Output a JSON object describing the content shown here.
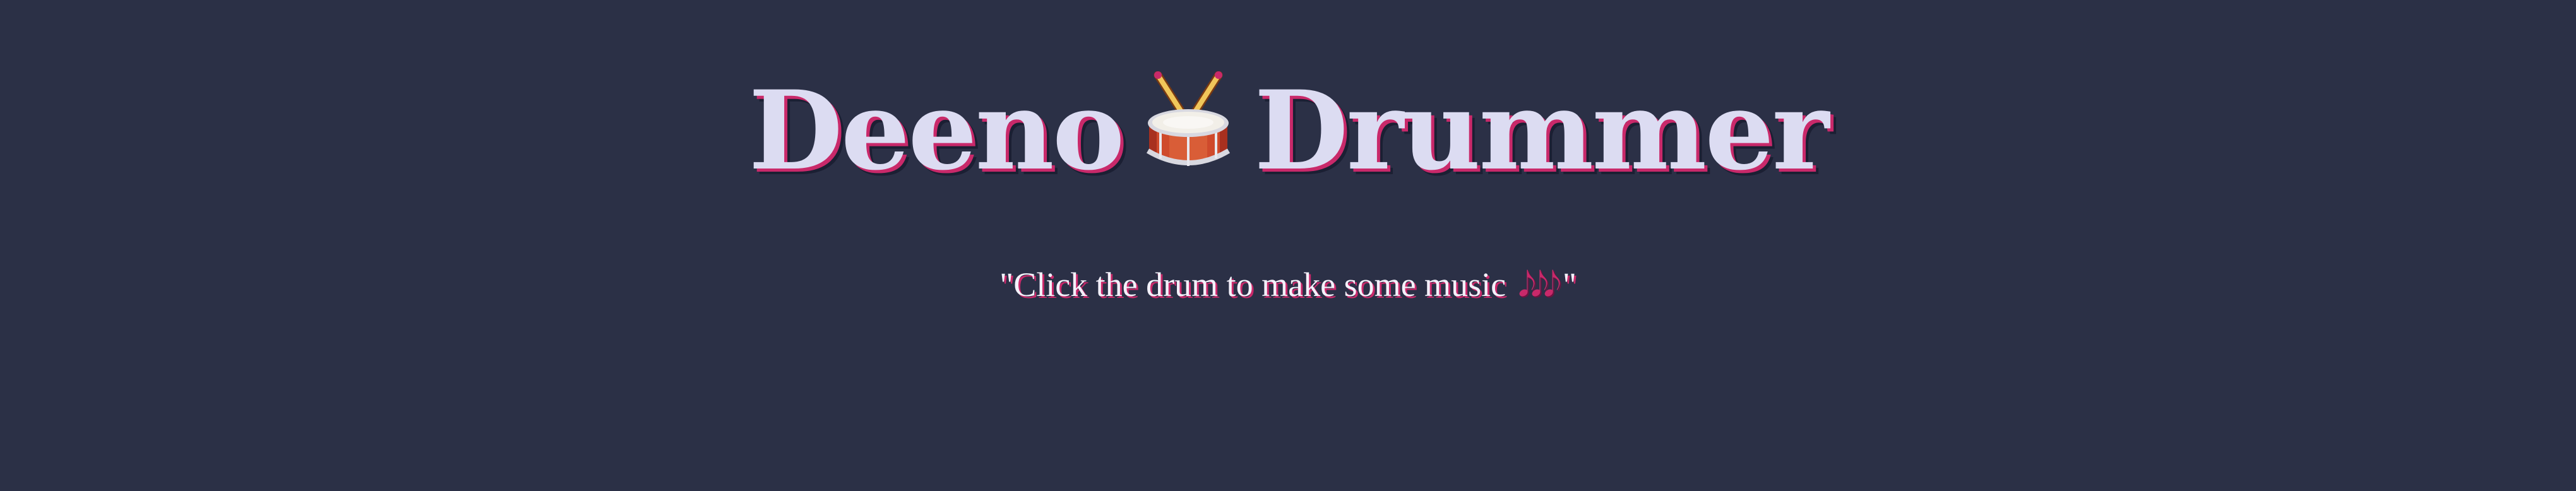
{
  "header": {
    "title_part1": "Deeno",
    "title_part2": "Drummer",
    "title_icon": "drum-icon"
  },
  "instruction": {
    "quote_open": "\"",
    "text": "Click the drum to make some music",
    "notes_icon": "music-notes-icon",
    "notes_glyphs": "𝅘𝅥𝅮𝅘𝅥𝅮𝅘𝅥𝅮",
    "quote_close": "\""
  },
  "colors": {
    "background": "#2b3046",
    "title_text": "#dcdcf2",
    "accent_shadow": "#c9296a",
    "drum_shell": "#c0392b",
    "drum_head": "#f2efe8",
    "drum_rim": "#d8d8e0",
    "drumstick": "#f0c65a"
  }
}
